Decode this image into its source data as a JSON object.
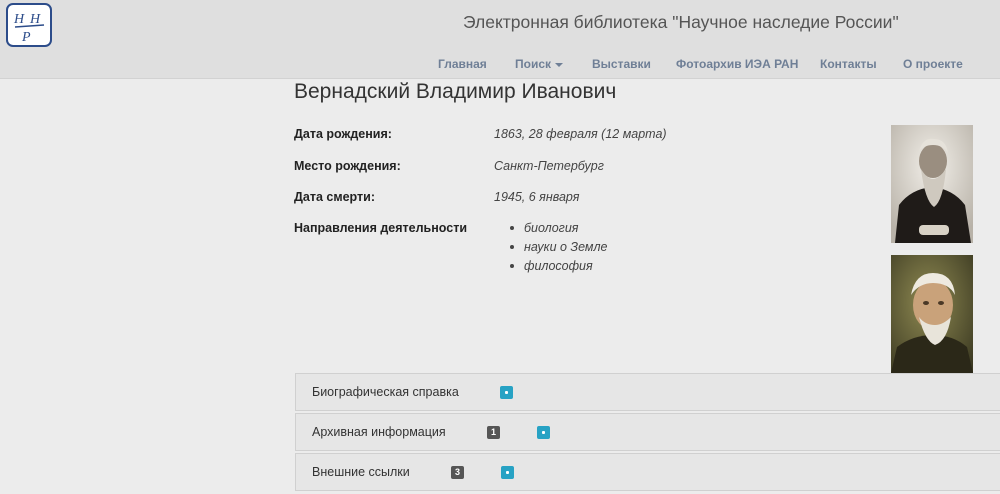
{
  "header": {
    "logo_letters": [
      "Н",
      "Н",
      "Р"
    ],
    "site_title": "Электронная библиотека \"Научное наследие России\"",
    "nav": [
      {
        "label": "Главная"
      },
      {
        "label": "Поиск",
        "dropdown": true
      },
      {
        "label": "Выставки"
      },
      {
        "label": "Фотоархив ИЭА РАН"
      },
      {
        "label": "Контакты"
      },
      {
        "label": "О проекте"
      }
    ]
  },
  "person": {
    "name": "Вернадский Владимир Иванович",
    "fields": [
      {
        "label": "Дата рождения:",
        "value": "1863, 28 февраля (12 марта)"
      },
      {
        "label": "Место рождения:",
        "value": "Санкт-Петербург"
      },
      {
        "label": "Дата смерти:",
        "value": "1945, 6 января"
      }
    ],
    "activities_label": "Направления деятельности",
    "activities": [
      "биология",
      "науки о Земле",
      "философия"
    ]
  },
  "photos": [
    {
      "description": "sepia-portrait"
    },
    {
      "description": "painted-portrait"
    }
  ],
  "panels": [
    {
      "title": "Биографическая справка",
      "count": null
    },
    {
      "title": "Архивная информация",
      "count": "1"
    },
    {
      "title": "Внешние ссылки",
      "count": "3"
    }
  ],
  "colors": {
    "header_bg": "#dfdfdf",
    "nav_text": "#6f7f96",
    "plus_button": "#27a2c4",
    "count_badge": "#555555",
    "logo": "#2c4c8a"
  }
}
